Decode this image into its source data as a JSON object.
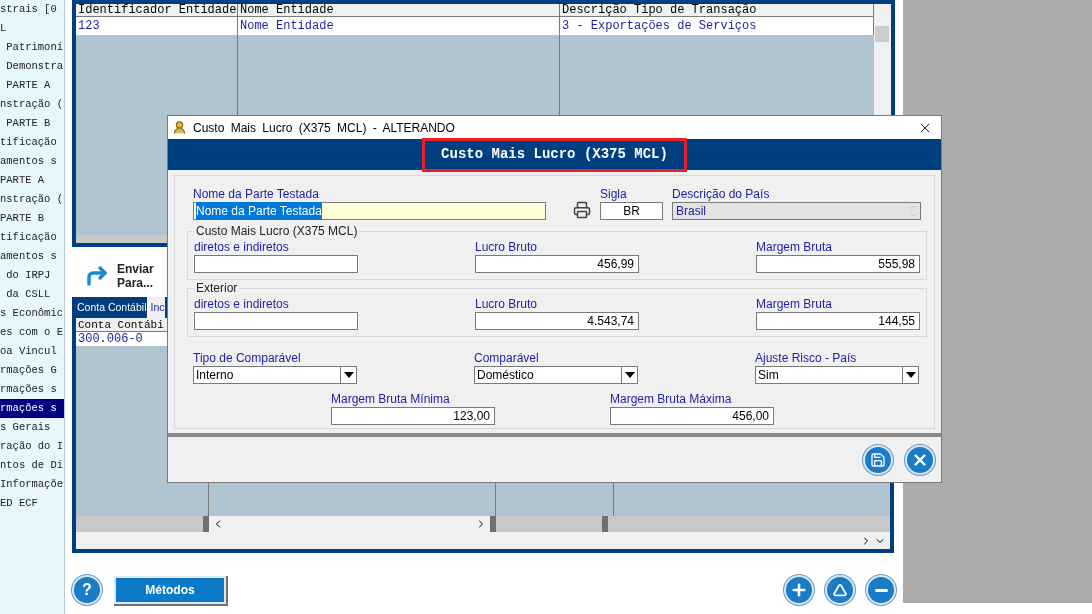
{
  "sidebar": {
    "items": [
      {
        "label": "strais [0",
        "selected": false
      },
      {
        "label": "L",
        "selected": false
      },
      {
        "label": " Patrimoni",
        "selected": false
      },
      {
        "label": " Demonstra",
        "selected": false
      },
      {
        "label": " PARTE A",
        "selected": false
      },
      {
        "label": "nstração (",
        "selected": false
      },
      {
        "label": " PARTE B",
        "selected": false
      },
      {
        "label": "tificação",
        "selected": false
      },
      {
        "label": "amentos s",
        "selected": false
      },
      {
        "label": "PARTE A",
        "selected": false
      },
      {
        "label": "nstração (",
        "selected": false
      },
      {
        "label": "PARTE B",
        "selected": false
      },
      {
        "label": "tificação",
        "selected": false
      },
      {
        "label": "amentos s",
        "selected": false
      },
      {
        "label": " do IRPJ",
        "selected": false
      },
      {
        "label": " da CSLL",
        "selected": false
      },
      {
        "label": "s Econômic",
        "selected": false
      },
      {
        "label": "es com o E",
        "selected": false
      },
      {
        "label": "oa Vincul",
        "selected": false
      },
      {
        "label": "rmações G",
        "selected": false
      },
      {
        "label": "rmações s",
        "selected": false
      },
      {
        "label": "rmações s",
        "selected": true
      },
      {
        "label": "s Gerais",
        "selected": false
      },
      {
        "label": "ração do I",
        "selected": false
      },
      {
        "label": "ntos de Di",
        "selected": false
      },
      {
        "label": "Informaçõe",
        "selected": false
      },
      {
        "label": "ED ECF",
        "selected": false
      }
    ]
  },
  "upper_table": {
    "columns": [
      "Identificador Entidade",
      "Nome Entidade",
      "Descrição Tipo de Transação"
    ],
    "rows": [
      [
        "123",
        "Nome Entidade",
        "3 - Exportações de Serviços"
      ]
    ]
  },
  "send_button": {
    "label": "Enviar Para..."
  },
  "tabs": [
    {
      "label": "Conta Contábil",
      "selected": true
    },
    {
      "label": "Inc",
      "selected": false
    }
  ],
  "lower_table": {
    "columns": [
      "Conta Contábi"
    ],
    "rows": [
      [
        "300.006-0"
      ]
    ]
  },
  "bottom_bar": {
    "help": "?",
    "methods_button": "Métodos"
  },
  "dialog": {
    "title": "Custo Mais Lucro (X375 MCL) - ALTERANDO",
    "header": "Custo Mais Lucro (X375 MCL)",
    "party": {
      "label": "Nome da Parte Testada",
      "value": "Nome da Parte Testada",
      "selected": true
    },
    "sigla": {
      "label": "Sigla",
      "value": "BR"
    },
    "country": {
      "label": "Descrição do País",
      "value": "Brasil",
      "disabled": true
    },
    "groups": [
      {
        "legend": "Custo Mais Lucro (X375 MCL)",
        "fields": [
          {
            "label": "diretos e indiretos"
          },
          {
            "label": "Lucro Bruto",
            "value": "456,99"
          },
          {
            "label": "Margem Bruta",
            "value": "555,98"
          }
        ]
      },
      {
        "legend": "Exterior",
        "fields": [
          {
            "label": "diretos e indiretos"
          },
          {
            "label": "Lucro Bruto",
            "value": "4.543,74"
          },
          {
            "label": "Margem Bruta",
            "value": "144,55"
          }
        ]
      }
    ],
    "selects": [
      {
        "label": "Tipo de Comparável",
        "value": "Interno"
      },
      {
        "label": "Comparável",
        "value": "Doméstico"
      },
      {
        "label": "Ajuste Risco - País",
        "value": "Sim"
      }
    ],
    "limits": [
      {
        "label": "Margem Bruta Mínima",
        "value": "123,00"
      },
      {
        "label": "Margem Bruta Máxima",
        "value": "456,00"
      }
    ]
  }
}
